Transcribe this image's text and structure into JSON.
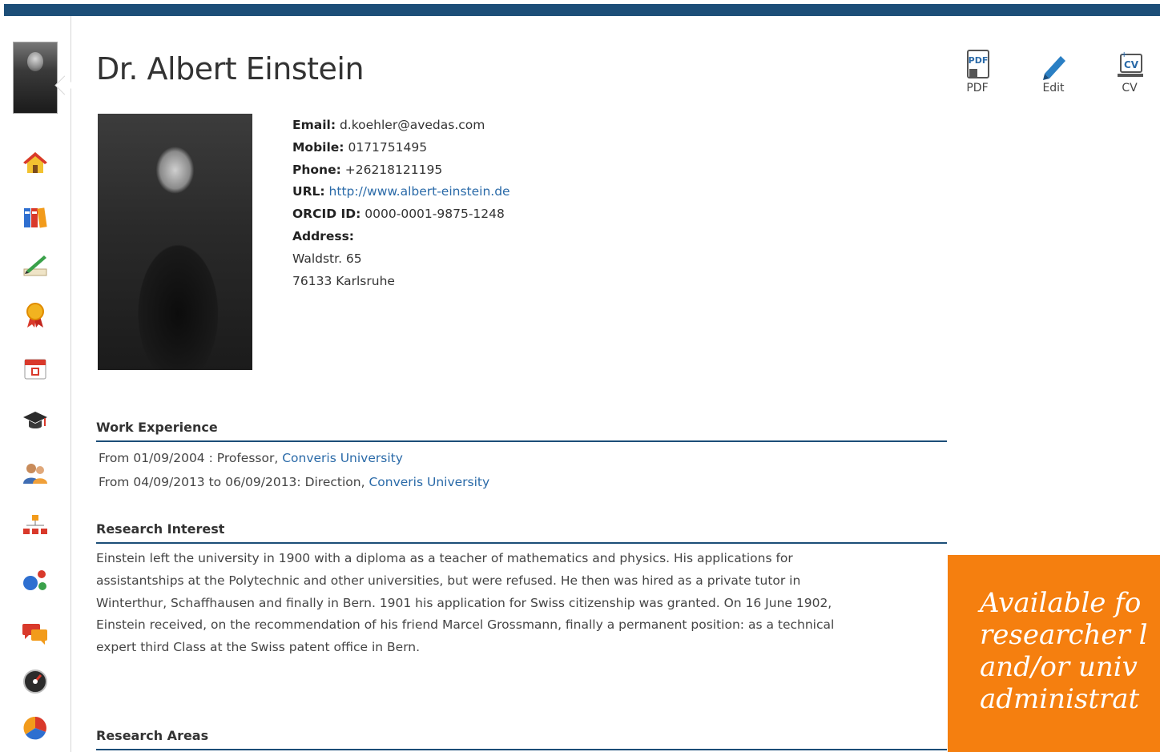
{
  "profile": {
    "name": "Dr. Albert Einstein",
    "email_label": "Email:",
    "email": "d.koehler@avedas.com",
    "mobile_label": "Mobile:",
    "mobile": "0171751495",
    "phone_label": "Phone:",
    "phone": "+26218121195",
    "url_label": "URL:",
    "url": "http://www.albert-einstein.de",
    "orcid_label": "ORCID ID:",
    "orcid": "0000-0001-9875-1248",
    "address_label": "Address:",
    "address_line1": "Waldstr. 65",
    "address_line2": "76133 Karlsruhe"
  },
  "toolbar": {
    "pdf_label": "PDF",
    "edit_label": "Edit",
    "cv_label": "CV"
  },
  "sidebar": {
    "items": [
      {
        "icon": "home-icon"
      },
      {
        "icon": "books-icon"
      },
      {
        "icon": "writing-icon"
      },
      {
        "icon": "award-ribbon-icon"
      },
      {
        "icon": "calendar-icon"
      },
      {
        "icon": "graduation-cap-icon"
      },
      {
        "icon": "people-icon"
      },
      {
        "icon": "org-chart-icon"
      },
      {
        "icon": "network-icon"
      },
      {
        "icon": "chat-bubbles-icon"
      },
      {
        "icon": "dashboard-gauge-icon"
      },
      {
        "icon": "pie-chart-icon"
      }
    ]
  },
  "work_experience": {
    "title": "Work Experience",
    "entries": [
      {
        "text": "From 01/09/2004 : Professor, ",
        "org": "Converis University"
      },
      {
        "text": "From 04/09/2013 to 06/09/2013: Direction, ",
        "org": "Converis University"
      }
    ]
  },
  "research_interest": {
    "title": "Research Interest",
    "lines": [
      "Einstein left the university in 1900 with a diploma as a teacher of mathematics and physics. His applications for",
      "assistantships at the Polytechnic and other universities, but were refused. He then was hired as a private tutor in",
      "Winterthur, Schaffhausen and finally in Bern. 1901 his application for Swiss citizenship was granted. On 16 June 1902,",
      "Einstein received, on the recommendation of his friend Marcel Grossmann, finally a permanent position: as a technical",
      "expert third Class at the Swiss patent office in Bern."
    ]
  },
  "research_areas": {
    "title": "Research Areas"
  },
  "promo": {
    "lines": [
      "Available fo",
      "researcher l",
      "and/or univ",
      "administrat"
    ]
  },
  "colors": {
    "header": "#1c4e78",
    "link": "#2a6aa8",
    "promo_bg": "#f57f0f"
  }
}
